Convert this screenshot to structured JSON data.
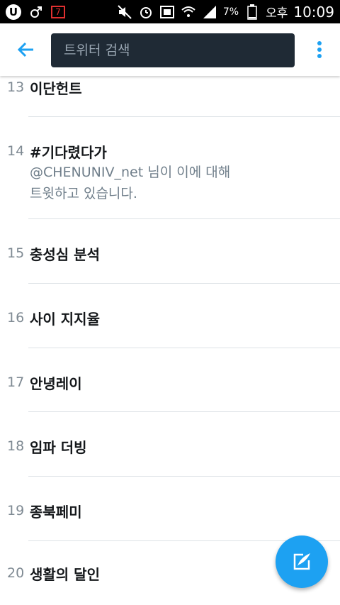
{
  "statusbar": {
    "battery": "7%",
    "ampm": "오후",
    "time": "10:09",
    "calendar_day": "7"
  },
  "toolbar": {
    "search_placeholder": "트위터 검색"
  },
  "trends": [
    {
      "rank": "13",
      "title": "이단헌트",
      "sub_lines": []
    },
    {
      "rank": "14",
      "title": "#기다렸다가",
      "sub_lines": [
        "@CHENUNIV_net 님이 이에 대해",
        "트윗하고 있습니다."
      ]
    },
    {
      "rank": "15",
      "title": "충성심 분석",
      "sub_lines": []
    },
    {
      "rank": "16",
      "title": "사이 지지율",
      "sub_lines": []
    },
    {
      "rank": "17",
      "title": "안녕레이",
      "sub_lines": []
    },
    {
      "rank": "18",
      "title": "임파 더빙",
      "sub_lines": []
    },
    {
      "rank": "19",
      "title": "종북페미",
      "sub_lines": []
    },
    {
      "rank": "20",
      "title": "생활의 달인",
      "sub_lines": []
    }
  ],
  "colors": {
    "accent": "#1da1f2",
    "search_bg": "#1f2a35"
  }
}
